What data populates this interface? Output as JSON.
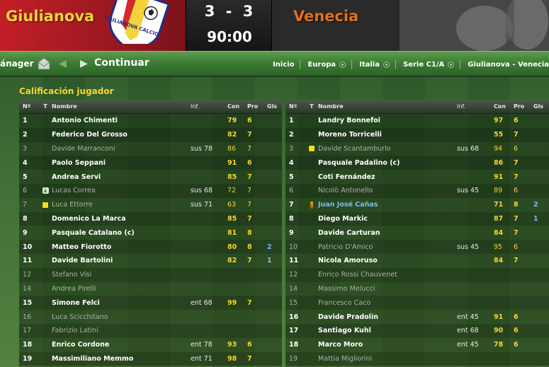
{
  "scoreboard": {
    "home_team": "Giulianova",
    "home_score": "3",
    "separator": "-",
    "away_score": "3",
    "clock": "90:00",
    "away_team": "Venecia",
    "crest_text": "GIULIANOVA CALCIO",
    "colors": {
      "home": "#c21f27",
      "home_text": "#f2d33b",
      "away_text": "#e2701a"
    }
  },
  "navbar": {
    "manager_label": "ánager",
    "continue_label": "Continuar",
    "breadcrumbs": [
      {
        "label": "Inicio",
        "dot": false
      },
      {
        "label": "Europa",
        "dot": true
      },
      {
        "label": "Italia",
        "dot": true
      },
      {
        "label": "Serie C1/A",
        "dot": true
      },
      {
        "label": "Giulianova - Venecia",
        "dot": false
      }
    ]
  },
  "section_title": "Calificación jugador",
  "columns": {
    "no": "Nº",
    "t": "T",
    "name": "Nombre",
    "inf": "Inf.",
    "con": "Con",
    "pro": "Pro",
    "gls": "Gls"
  },
  "home_players": [
    {
      "no": "1",
      "icon": "",
      "name": "Antonio Chimenti",
      "inf": "",
      "con": "79",
      "pro": "6",
      "gls": "",
      "status": "on"
    },
    {
      "no": "2",
      "icon": "",
      "name": "Federico Del Grosso",
      "inf": "",
      "con": "82",
      "pro": "7",
      "gls": "",
      "status": "on"
    },
    {
      "no": "3",
      "icon": "",
      "name": "Davide Marranconi",
      "inf": "sus 78",
      "con": "86",
      "pro": "7",
      "gls": "",
      "status": "sub"
    },
    {
      "no": "4",
      "icon": "",
      "name": "Paolo Seppani",
      "inf": "",
      "con": "91",
      "pro": "6",
      "gls": "",
      "status": "on"
    },
    {
      "no": "5",
      "icon": "",
      "name": "Andrea Servi",
      "inf": "",
      "con": "85",
      "pro": "7",
      "gls": "",
      "status": "on"
    },
    {
      "no": "6",
      "icon": "sub-arrow",
      "name": "Lucas Correa",
      "inf": "sus 68",
      "con": "72",
      "pro": "7",
      "gls": "",
      "status": "sub"
    },
    {
      "no": "7",
      "icon": "yellow-card",
      "name": "Luca Ettorre",
      "inf": "sus 71",
      "con": "63",
      "pro": "7",
      "gls": "",
      "status": "sub"
    },
    {
      "no": "8",
      "icon": "",
      "name": "Domenico La Marca",
      "inf": "",
      "con": "85",
      "pro": "7",
      "gls": "",
      "status": "on"
    },
    {
      "no": "9",
      "icon": "",
      "name": "Pasquale Catalano (c)",
      "inf": "",
      "con": "81",
      "pro": "8",
      "gls": "",
      "status": "on"
    },
    {
      "no": "10",
      "icon": "",
      "name": "Matteo Fiorotto",
      "inf": "",
      "con": "80",
      "pro": "8",
      "gls": "2",
      "status": "on"
    },
    {
      "no": "11",
      "icon": "",
      "name": "Davide Bartolini",
      "inf": "",
      "con": "82",
      "pro": "7",
      "gls": "1",
      "status": "on"
    },
    {
      "no": "12",
      "icon": "",
      "name": "Stefano Visi",
      "inf": "",
      "con": "",
      "pro": "",
      "gls": "",
      "status": "sub"
    },
    {
      "no": "14",
      "icon": "",
      "name": "Andrea Pirelli",
      "inf": "",
      "con": "",
      "pro": "",
      "gls": "",
      "status": "sub"
    },
    {
      "no": "15",
      "icon": "",
      "name": "Simone Felci",
      "inf": "ent 68",
      "con": "99",
      "pro": "7",
      "gls": "",
      "status": "on"
    },
    {
      "no": "16",
      "icon": "",
      "name": "Luca Scicchitano",
      "inf": "",
      "con": "",
      "pro": "",
      "gls": "",
      "status": "sub"
    },
    {
      "no": "17",
      "icon": "",
      "name": "Fabrizio Latini",
      "inf": "",
      "con": "",
      "pro": "",
      "gls": "",
      "status": "sub"
    },
    {
      "no": "18",
      "icon": "",
      "name": "Enrico Cordone",
      "inf": "ent 78",
      "con": "93",
      "pro": "6",
      "gls": "",
      "status": "on"
    },
    {
      "no": "19",
      "icon": "",
      "name": "Massimiliano Memmo",
      "inf": "ent 71",
      "con": "98",
      "pro": "7",
      "gls": "",
      "status": "on"
    }
  ],
  "away_players": [
    {
      "no": "1",
      "icon": "",
      "name": "Landry Bonnefoi",
      "inf": "",
      "con": "97",
      "pro": "6",
      "gls": "",
      "status": "on"
    },
    {
      "no": "2",
      "icon": "",
      "name": "Moreno Torricelli",
      "inf": "",
      "con": "55",
      "pro": "7",
      "gls": "",
      "status": "on"
    },
    {
      "no": "3",
      "icon": "yellow-card",
      "name": "Davide Scantamburlo",
      "inf": "sus 68",
      "con": "94",
      "pro": "6",
      "gls": "",
      "status": "sub"
    },
    {
      "no": "4",
      "icon": "",
      "name": "Pasquale Padalino (c)",
      "inf": "",
      "con": "86",
      "pro": "7",
      "gls": "",
      "status": "on"
    },
    {
      "no": "5",
      "icon": "",
      "name": "Coti Fernández",
      "inf": "",
      "con": "91",
      "pro": "7",
      "gls": "",
      "status": "on"
    },
    {
      "no": "6",
      "icon": "",
      "name": "Nicolò Antonello",
      "inf": "sus 45",
      "con": "89",
      "pro": "6",
      "gls": "",
      "status": "sub"
    },
    {
      "no": "7",
      "icon": "goal-marker",
      "name": "Juan José Cañas",
      "inf": "",
      "con": "71",
      "pro": "8",
      "gls": "2",
      "status": "star"
    },
    {
      "no": "8",
      "icon": "",
      "name": "Diego Markic",
      "inf": "",
      "con": "87",
      "pro": "7",
      "gls": "1",
      "status": "on"
    },
    {
      "no": "9",
      "icon": "",
      "name": "Davide Carturan",
      "inf": "",
      "con": "84",
      "pro": "7",
      "gls": "",
      "status": "on"
    },
    {
      "no": "10",
      "icon": "",
      "name": "Patricio D'Amico",
      "inf": "sus 45",
      "con": "95",
      "pro": "6",
      "gls": "",
      "status": "sub"
    },
    {
      "no": "11",
      "icon": "",
      "name": "Nicola Amoruso",
      "inf": "",
      "con": "84",
      "pro": "7",
      "gls": "",
      "status": "on"
    },
    {
      "no": "12",
      "icon": "",
      "name": "Enrico Rossi Chauvenet",
      "inf": "",
      "con": "",
      "pro": "",
      "gls": "",
      "status": "sub"
    },
    {
      "no": "14",
      "icon": "",
      "name": "Massimo Melucci",
      "inf": "",
      "con": "",
      "pro": "",
      "gls": "",
      "status": "sub"
    },
    {
      "no": "15",
      "icon": "",
      "name": "Francesco Caco",
      "inf": "",
      "con": "",
      "pro": "",
      "gls": "",
      "status": "sub"
    },
    {
      "no": "16",
      "icon": "",
      "name": "Davide Pradolin",
      "inf": "ent 45",
      "con": "91",
      "pro": "6",
      "gls": "",
      "status": "on"
    },
    {
      "no": "17",
      "icon": "",
      "name": "Santiago Kuhl",
      "inf": "ent 68",
      "con": "90",
      "pro": "6",
      "gls": "",
      "status": "on"
    },
    {
      "no": "18",
      "icon": "",
      "name": "Marco Moro",
      "inf": "ent 45",
      "con": "78",
      "pro": "6",
      "gls": "",
      "status": "on"
    },
    {
      "no": "19",
      "icon": "",
      "name": "Mattia Migliorini",
      "inf": "",
      "con": "",
      "pro": "",
      "gls": "",
      "status": "sub"
    }
  ]
}
